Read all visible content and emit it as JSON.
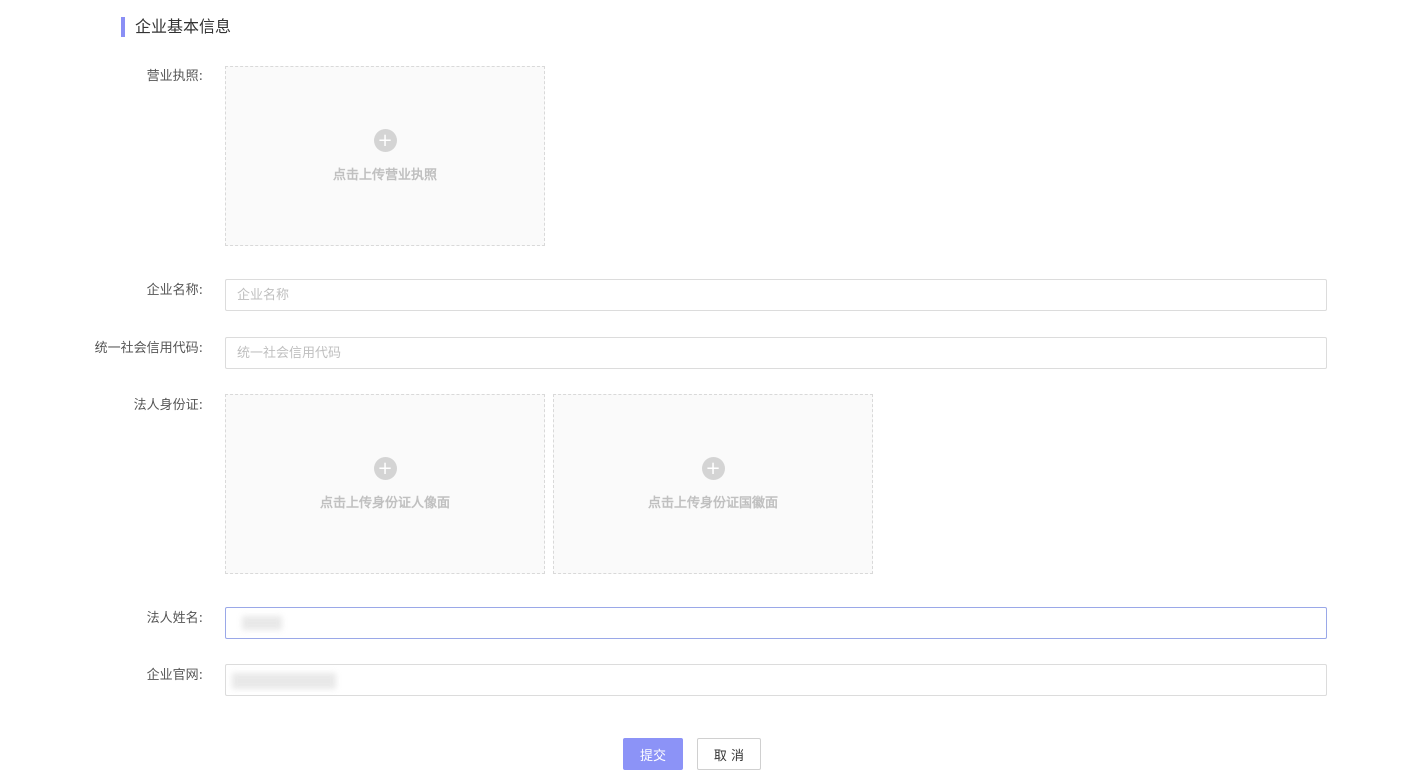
{
  "section": {
    "title": "企业基本信息"
  },
  "fields": {
    "business_license": {
      "label": "营业执照:",
      "upload_text": "点击上传营业执照"
    },
    "company_name": {
      "label": "企业名称:",
      "placeholder": "企业名称",
      "value": ""
    },
    "credit_code": {
      "label": "统一社会信用代码:",
      "placeholder": "统一社会信用代码",
      "value": ""
    },
    "legal_id": {
      "label": "法人身份证:",
      "front_upload_text": "点击上传身份证人像面",
      "back_upload_text": "点击上传身份证国徽面"
    },
    "legal_name": {
      "label": "法人姓名:"
    },
    "website": {
      "label": "企业官网:"
    }
  },
  "buttons": {
    "submit": "提交",
    "cancel": "取 消"
  },
  "colors": {
    "accent": "#8c93f7",
    "section_bar": "#8a8ff5"
  },
  "icons": {
    "upload": "plus-circle-icon"
  }
}
